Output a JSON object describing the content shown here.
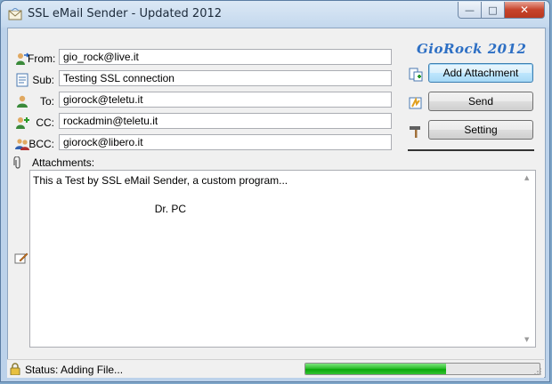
{
  "window": {
    "title": "SSL eMail Sender - Updated 2012"
  },
  "brand": "GioRock 2012",
  "fields": {
    "from": {
      "label": "From:",
      "value": "gio_rock@live.it"
    },
    "subject": {
      "label": "Sub:",
      "value": "Testing SSL connection"
    },
    "to": {
      "label": "To:",
      "value": "giorock@teletu.it"
    },
    "cc": {
      "label": "CC:",
      "value": "rockadmin@teletu.it"
    },
    "bcc": {
      "label": "BCC:",
      "value": "giorock@libero.it"
    }
  },
  "buttons": {
    "add_attachment": "Add Attachment",
    "send": "Send",
    "setting": "Setting"
  },
  "attachments_label": "Attachments:",
  "body": "This a Test by SSL eMail Sender, a custom program...\n\n                                         Dr. PC",
  "status": {
    "text": "Status: Adding File...",
    "progress": 0.6
  },
  "colors": {
    "brand": "#2d6fc4",
    "progress": "#22b822"
  }
}
